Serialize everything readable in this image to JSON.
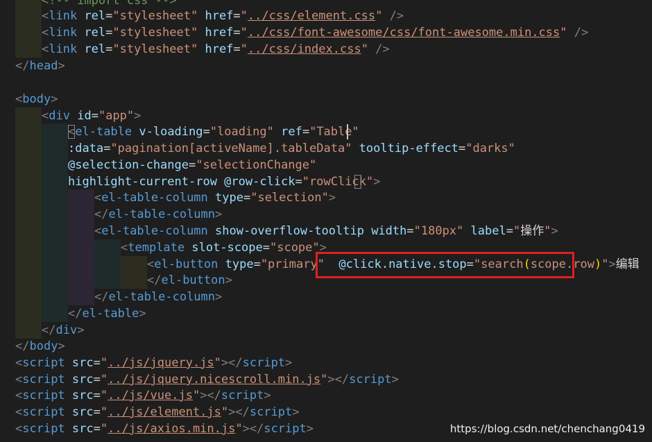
{
  "lines": [
    {
      "segments": [
        {
          "t": "<!-- import css -->",
          "c": "cmt"
        }
      ]
    },
    {
      "segments": [
        {
          "t": "<",
          "c": "punc"
        },
        {
          "t": "link",
          "c": "tag"
        },
        {
          "t": " rel",
          "c": "attr"
        },
        {
          "t": "=",
          "c": "plain"
        },
        {
          "t": "\"stylesheet\"",
          "c": "str"
        },
        {
          "t": " href",
          "c": "attr"
        },
        {
          "t": "=",
          "c": "plain"
        },
        {
          "t": "\"",
          "c": "str"
        },
        {
          "t": "../css/element.css",
          "c": "str link"
        },
        {
          "t": "\"",
          "c": "str"
        },
        {
          "t": " />",
          "c": "punc"
        }
      ]
    },
    {
      "segments": [
        {
          "t": "<",
          "c": "punc"
        },
        {
          "t": "link",
          "c": "tag"
        },
        {
          "t": " rel",
          "c": "attr"
        },
        {
          "t": "=",
          "c": "plain"
        },
        {
          "t": "\"stylesheet\"",
          "c": "str"
        },
        {
          "t": " href",
          "c": "attr"
        },
        {
          "t": "=",
          "c": "plain"
        },
        {
          "t": "\"",
          "c": "str"
        },
        {
          "t": "../css/font-awesome/css/font-awesome.min.css",
          "c": "str link"
        },
        {
          "t": "\"",
          "c": "str"
        },
        {
          "t": " />",
          "c": "punc"
        }
      ]
    },
    {
      "segments": [
        {
          "t": "<",
          "c": "punc"
        },
        {
          "t": "link",
          "c": "tag"
        },
        {
          "t": " rel",
          "c": "attr"
        },
        {
          "t": "=",
          "c": "plain"
        },
        {
          "t": "\"stylesheet\"",
          "c": "str"
        },
        {
          "t": " href",
          "c": "attr"
        },
        {
          "t": "=",
          "c": "plain"
        },
        {
          "t": "\"",
          "c": "str"
        },
        {
          "t": "../css/index.css",
          "c": "str link"
        },
        {
          "t": "\"",
          "c": "str"
        },
        {
          "t": " />",
          "c": "punc"
        }
      ]
    },
    {
      "segments": [
        {
          "t": "</",
          "c": "punc"
        },
        {
          "t": "head",
          "c": "tag"
        },
        {
          "t": ">",
          "c": "punc"
        }
      ]
    },
    {
      "segments": []
    },
    {
      "segments": [
        {
          "t": "<",
          "c": "punc"
        },
        {
          "t": "body",
          "c": "tag"
        },
        {
          "t": ">",
          "c": "punc"
        }
      ]
    },
    {
      "segments": [
        {
          "t": "<",
          "c": "punc"
        },
        {
          "t": "div",
          "c": "tag"
        },
        {
          "t": " id",
          "c": "attr"
        },
        {
          "t": "=",
          "c": "plain"
        },
        {
          "t": "\"app\"",
          "c": "str"
        },
        {
          "t": ">",
          "c": "punc"
        }
      ]
    },
    {
      "segments": [
        {
          "t": "<",
          "c": "punc"
        },
        {
          "t": "el-table",
          "c": "tag"
        },
        {
          "t": " v-loading",
          "c": "attr"
        },
        {
          "t": "=",
          "c": "plain"
        },
        {
          "t": "\"loading\"",
          "c": "str"
        },
        {
          "t": " ref",
          "c": "attr"
        },
        {
          "t": "=",
          "c": "plain"
        },
        {
          "t": "\"Table\"",
          "c": "str"
        }
      ]
    },
    {
      "segments": [
        {
          "t": ":data",
          "c": "attr"
        },
        {
          "t": "=",
          "c": "plain"
        },
        {
          "t": "\"pagination[activeName].tableData\"",
          "c": "str"
        },
        {
          "t": " tooltip-effect",
          "c": "attr"
        },
        {
          "t": "=",
          "c": "plain"
        },
        {
          "t": "\"darks\"",
          "c": "str"
        }
      ]
    },
    {
      "segments": [
        {
          "t": "@selection-change",
          "c": "attr"
        },
        {
          "t": "=",
          "c": "plain"
        },
        {
          "t": "\"selectionChange\"",
          "c": "str"
        }
      ]
    },
    {
      "segments": [
        {
          "t": "highlight-current-row",
          "c": "attr"
        },
        {
          "t": " @row-click",
          "c": "attr"
        },
        {
          "t": "=",
          "c": "plain"
        },
        {
          "t": "\"rowClick\"",
          "c": "str"
        },
        {
          "t": ">",
          "c": "punc"
        }
      ]
    },
    {
      "segments": [
        {
          "t": "<",
          "c": "punc"
        },
        {
          "t": "el-table-column",
          "c": "tag"
        },
        {
          "t": " type",
          "c": "attr"
        },
        {
          "t": "=",
          "c": "plain"
        },
        {
          "t": "\"selection\"",
          "c": "str"
        },
        {
          "t": ">",
          "c": "punc"
        }
      ]
    },
    {
      "segments": [
        {
          "t": "</",
          "c": "punc"
        },
        {
          "t": "el-table-column",
          "c": "tag"
        },
        {
          "t": ">",
          "c": "punc"
        }
      ]
    },
    {
      "segments": [
        {
          "t": "<",
          "c": "punc"
        },
        {
          "t": "el-table-column",
          "c": "tag"
        },
        {
          "t": " show-overflow-tooltip",
          "c": "attr"
        },
        {
          "t": " width",
          "c": "attr"
        },
        {
          "t": "=",
          "c": "plain"
        },
        {
          "t": "\"180px\"",
          "c": "str"
        },
        {
          "t": " label",
          "c": "attr"
        },
        {
          "t": "=",
          "c": "plain"
        },
        {
          "t": "\"",
          "c": "str"
        },
        {
          "t": "操作",
          "c": "str cjk"
        },
        {
          "t": "\"",
          "c": "str"
        },
        {
          "t": ">",
          "c": "punc"
        }
      ]
    },
    {
      "segments": [
        {
          "t": "<",
          "c": "punc"
        },
        {
          "t": "template",
          "c": "tag"
        },
        {
          "t": " slot-scope",
          "c": "attr"
        },
        {
          "t": "=",
          "c": "plain"
        },
        {
          "t": "\"scope\"",
          "c": "str"
        },
        {
          "t": ">",
          "c": "punc"
        }
      ]
    },
    {
      "segments": [
        {
          "t": "<",
          "c": "punc"
        },
        {
          "t": "el-button",
          "c": "tag"
        },
        {
          "t": " type",
          "c": "attr"
        },
        {
          "t": "=",
          "c": "plain"
        },
        {
          "t": "\"primary\"",
          "c": "str"
        },
        {
          "t": "  ",
          "c": "plain"
        },
        {
          "t": "@click.native.stop",
          "c": "attr"
        },
        {
          "t": "=",
          "c": "plain"
        },
        {
          "t": "\"search",
          "c": "str"
        },
        {
          "t": "(",
          "c": "yel"
        },
        {
          "t": "scope.row",
          "c": "str"
        },
        {
          "t": ")",
          "c": "yel"
        },
        {
          "t": "\"",
          "c": "str"
        },
        {
          "t": ">",
          "c": "punc"
        },
        {
          "t": "编辑",
          "c": "cjk"
        }
      ]
    },
    {
      "segments": [
        {
          "t": "</",
          "c": "punc"
        },
        {
          "t": "el-button",
          "c": "tag"
        },
        {
          "t": ">",
          "c": "punc"
        }
      ]
    },
    {
      "segments": [
        {
          "t": "</",
          "c": "punc"
        },
        {
          "t": "el-table-column",
          "c": "tag"
        },
        {
          "t": ">",
          "c": "punc"
        }
      ]
    },
    {
      "segments": [
        {
          "t": "</",
          "c": "punc"
        },
        {
          "t": "el-table",
          "c": "tag"
        },
        {
          "t": ">",
          "c": "punc"
        }
      ]
    },
    {
      "segments": [
        {
          "t": "</",
          "c": "punc"
        },
        {
          "t": "div",
          "c": "tag"
        },
        {
          "t": ">",
          "c": "punc"
        }
      ]
    },
    {
      "segments": [
        {
          "t": "</",
          "c": "punc"
        },
        {
          "t": "body",
          "c": "tag"
        },
        {
          "t": ">",
          "c": "punc"
        }
      ]
    },
    {
      "segments": [
        {
          "t": "<",
          "c": "punc"
        },
        {
          "t": "script",
          "c": "tag"
        },
        {
          "t": " src",
          "c": "attr"
        },
        {
          "t": "=",
          "c": "plain"
        },
        {
          "t": "\"",
          "c": "str"
        },
        {
          "t": "../js/jquery.js",
          "c": "str link"
        },
        {
          "t": "\"",
          "c": "str"
        },
        {
          "t": "></",
          "c": "punc"
        },
        {
          "t": "script",
          "c": "tag"
        },
        {
          "t": ">",
          "c": "punc"
        }
      ]
    },
    {
      "segments": [
        {
          "t": "<",
          "c": "punc"
        },
        {
          "t": "script",
          "c": "tag"
        },
        {
          "t": " src",
          "c": "attr"
        },
        {
          "t": "=",
          "c": "plain"
        },
        {
          "t": "\"",
          "c": "str"
        },
        {
          "t": "../js/jquery.nicescroll.min.js",
          "c": "str link"
        },
        {
          "t": "\"",
          "c": "str"
        },
        {
          "t": "></",
          "c": "punc"
        },
        {
          "t": "script",
          "c": "tag"
        },
        {
          "t": ">",
          "c": "punc"
        }
      ]
    },
    {
      "segments": [
        {
          "t": "<",
          "c": "punc"
        },
        {
          "t": "script",
          "c": "tag"
        },
        {
          "t": " src",
          "c": "attr"
        },
        {
          "t": "=",
          "c": "plain"
        },
        {
          "t": "\"",
          "c": "str"
        },
        {
          "t": "../js/vue.js",
          "c": "str link"
        },
        {
          "t": "\"",
          "c": "str"
        },
        {
          "t": "></",
          "c": "punc"
        },
        {
          "t": "script",
          "c": "tag"
        },
        {
          "t": ">",
          "c": "punc"
        }
      ]
    },
    {
      "segments": [
        {
          "t": "<",
          "c": "punc"
        },
        {
          "t": "script",
          "c": "tag"
        },
        {
          "t": " src",
          "c": "attr"
        },
        {
          "t": "=",
          "c": "plain"
        },
        {
          "t": "\"",
          "c": "str"
        },
        {
          "t": "../js/element.js",
          "c": "str link"
        },
        {
          "t": "\"",
          "c": "str"
        },
        {
          "t": "></",
          "c": "punc"
        },
        {
          "t": "script",
          "c": "tag"
        },
        {
          "t": ">",
          "c": "punc"
        }
      ]
    },
    {
      "segments": [
        {
          "t": "<",
          "c": "punc"
        },
        {
          "t": "script",
          "c": "tag"
        },
        {
          "t": " src",
          "c": "attr"
        },
        {
          "t": "=",
          "c": "plain"
        },
        {
          "t": "\"",
          "c": "str"
        },
        {
          "t": "../js/axios.min.js",
          "c": "str link"
        },
        {
          "t": "\"",
          "c": "str"
        },
        {
          "t": "></",
          "c": "punc"
        },
        {
          "t": "script",
          "c": "tag"
        },
        {
          "t": ">",
          "c": "punc"
        }
      ]
    }
  ],
  "watermark": "https://blog.csdn.net/chenchang0419"
}
